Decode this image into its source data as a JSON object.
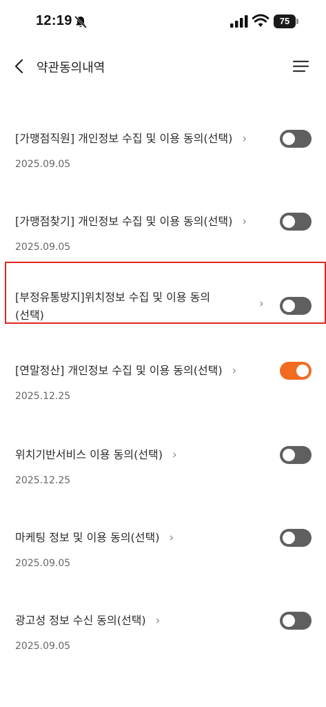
{
  "status_bar": {
    "time": "12:19",
    "battery": "75"
  },
  "header": {
    "title": "약관동의내역"
  },
  "colors": {
    "toggle_on": "#f36b21",
    "toggle_off": "#5f5f5f",
    "highlight": "#e0261c"
  },
  "items": [
    {
      "title": "[가맹점직원] 개인정보 수집 및 이용 동의(선택)",
      "date": "2025.09.05",
      "enabled": false
    },
    {
      "title": "[가맹점찾기] 개인정보 수집 및 이용 동의(선택)",
      "date": "2025.09.05",
      "enabled": false
    },
    {
      "title_line1": "[부정유통방지]위치정보 수집 및 이용 동의",
      "title_line2": "(선택)",
      "enabled": false
    },
    {
      "title": "[연말정산] 개인정보 수집 및 이용 동의(선택)",
      "date": "2025.12.25",
      "enabled": true,
      "highlighted": true
    },
    {
      "title": "위치기반서비스 이용 동의(선택)",
      "date": "2025.12.25",
      "enabled": false
    },
    {
      "title": "마케팅 정보 및 이용 동의(선택)",
      "date": "2025.09.05",
      "enabled": false
    },
    {
      "title": "광고성 정보 수신 동의(선택)",
      "date": "2025.09.05",
      "enabled": false
    }
  ]
}
